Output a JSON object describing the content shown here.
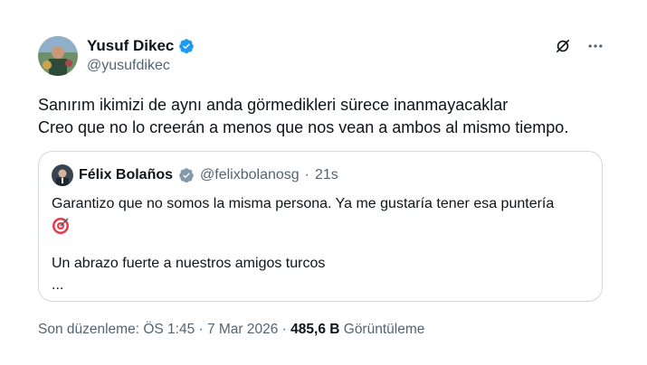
{
  "author": {
    "name": "Yusuf Dikec",
    "handle": "@yusufdikec"
  },
  "tweet": {
    "line1": "Sanırım ikimizi de aynı anda görmedikleri sürece inanmayacaklar",
    "line2": "Creo que no lo creerán a menos que nos vean a ambos al mismo tiempo."
  },
  "quote": {
    "name": "Félix Bolaños",
    "handle": "@felixbolanosg",
    "separator": "·",
    "time": "21s",
    "line1": "Garantizo que no somos la misma persona. Ya me gustaría tener esa puntería",
    "line3": "Un abrazo fuerte a nuestros amigos turcos",
    "line4": "..."
  },
  "footer": {
    "edited": "Son düzenleme: ÖS 1:45 · 7 Mar 2026 · ",
    "views_count": "485,6 B",
    "views_label": " Görüntüleme"
  },
  "colors": {
    "verified": "#1d9bf0",
    "muted": "#536471",
    "border": "#cfd9de"
  },
  "icons": {
    "verified": "verified-badge-icon",
    "grok": "grok-icon",
    "more": "more-icon",
    "target": "direct-hit-emoji-icon"
  }
}
